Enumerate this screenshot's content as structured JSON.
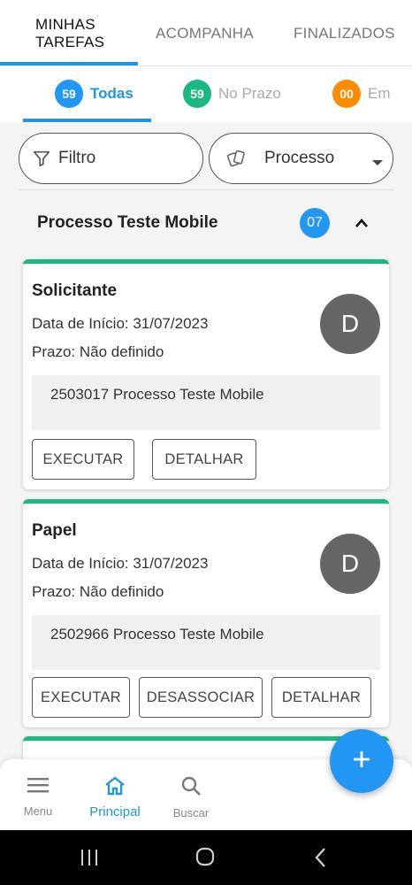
{
  "tabs": {
    "items": [
      {
        "label": "MINHAS TAREFAS"
      },
      {
        "label": "ACOMPANHAMENTO"
      },
      {
        "label": "FINALIZADOS"
      }
    ]
  },
  "filter_tabs": [
    {
      "count": "59",
      "label": "Todas",
      "color": "#2196f3"
    },
    {
      "count": "59",
      "label": "No Prazo",
      "color": "#1db880"
    },
    {
      "count": "00",
      "label": "Em",
      "color": "#fb8c00"
    }
  ],
  "search": {
    "filter_label": "Filtro",
    "process_label": "Processo"
  },
  "group": {
    "title": "Processo Teste Mobile",
    "count": "07"
  },
  "cards": [
    {
      "title": "Solicitante",
      "start_date": "Data de Início: 31/07/2023",
      "deadline": "Prazo: Não definido",
      "avatar": "D",
      "process": "2503017 Processo Teste Mobile",
      "buttons": [
        "EXECUTAR",
        "DETALHAR"
      ]
    },
    {
      "title": "Papel",
      "start_date": "Data de Início: 31/07/2023",
      "deadline": "Prazo: Não definido",
      "avatar": "D",
      "process": "2502966 Processo Teste Mobile",
      "buttons": [
        "EXECUTAR",
        "DESASSOCIAR",
        "DETALHAR"
      ]
    }
  ],
  "bottom_nav": [
    {
      "label": "Menu",
      "icon": "menu-icon"
    },
    {
      "label": "Principal",
      "icon": "home-icon"
    },
    {
      "label": "Buscar",
      "icon": "search-icon"
    }
  ],
  "colors": {
    "accent": "#2196d9",
    "green": "#1db880",
    "orange": "#fb8c00"
  }
}
